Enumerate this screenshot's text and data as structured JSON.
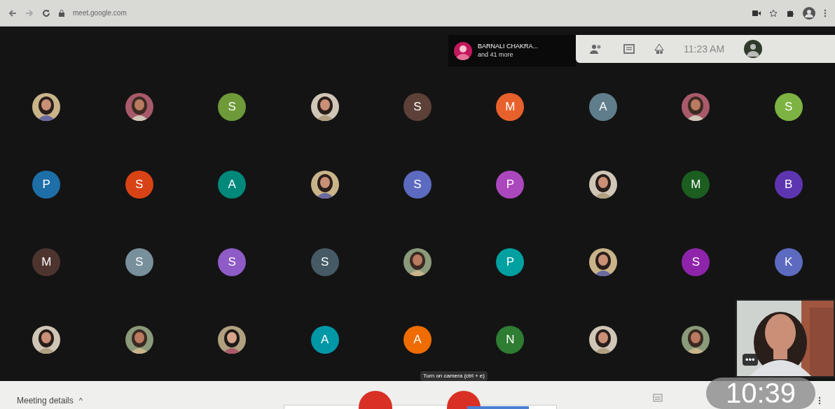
{
  "browser": {
    "url": "meet.google.com"
  },
  "header": {
    "presenter_name": "BARNALI CHAKRA...",
    "presenter_more": "and 41 more",
    "time": "11:23 AM"
  },
  "participants": [
    {
      "kind": "picture"
    },
    {
      "kind": "picture"
    },
    {
      "kind": "letter",
      "letter": "S",
      "color": "#6e9a3a"
    },
    {
      "kind": "picture"
    },
    {
      "kind": "letter",
      "letter": "S",
      "color": "#5d4037"
    },
    {
      "kind": "letter",
      "letter": "M",
      "color": "#e8602c"
    },
    {
      "kind": "letter",
      "letter": "A",
      "color": "#607d8b"
    },
    {
      "kind": "picture"
    },
    {
      "kind": "letter",
      "letter": "S",
      "color": "#7cb342"
    },
    {
      "kind": "letter",
      "letter": "P",
      "color": "#1e6fa8"
    },
    {
      "kind": "letter",
      "letter": "S",
      "color": "#d84315"
    },
    {
      "kind": "letter",
      "letter": "A",
      "color": "#00897b"
    },
    {
      "kind": "picture"
    },
    {
      "kind": "letter",
      "letter": "S",
      "color": "#5c6bc0"
    },
    {
      "kind": "letter",
      "letter": "P",
      "color": "#ab47bc"
    },
    {
      "kind": "picture"
    },
    {
      "kind": "letter",
      "letter": "M",
      "color": "#1b5e20"
    },
    {
      "kind": "letter",
      "letter": "B",
      "color": "#5e35b1"
    },
    {
      "kind": "letter",
      "letter": "M",
      "color": "#4e342e"
    },
    {
      "kind": "letter",
      "letter": "S",
      "color": "#78909c"
    },
    {
      "kind": "letter",
      "letter": "S",
      "color": "#8e5bc7"
    },
    {
      "kind": "letter",
      "letter": "S",
      "color": "#455a64"
    },
    {
      "kind": "picture"
    },
    {
      "kind": "letter",
      "letter": "P",
      "color": "#00a0a0"
    },
    {
      "kind": "picture"
    },
    {
      "kind": "letter",
      "letter": "S",
      "color": "#8e24aa"
    },
    {
      "kind": "letter",
      "letter": "K",
      "color": "#5c6bc0"
    },
    {
      "kind": "picture"
    },
    {
      "kind": "picture"
    },
    {
      "kind": "picture"
    },
    {
      "kind": "letter",
      "letter": "A",
      "color": "#0097a7"
    },
    {
      "kind": "letter",
      "letter": "A",
      "color": "#ef6c00"
    },
    {
      "kind": "letter",
      "letter": "N",
      "color": "#2e7d32"
    },
    {
      "kind": "picture"
    },
    {
      "kind": "picture"
    }
  ],
  "self_view": {
    "more": "•••"
  },
  "tooltip": "Turn on camera (ctrl + e)",
  "bottom_bar": {
    "meeting_details": "Meeting details",
    "caret": "^"
  },
  "clock_overlay": "10:39"
}
